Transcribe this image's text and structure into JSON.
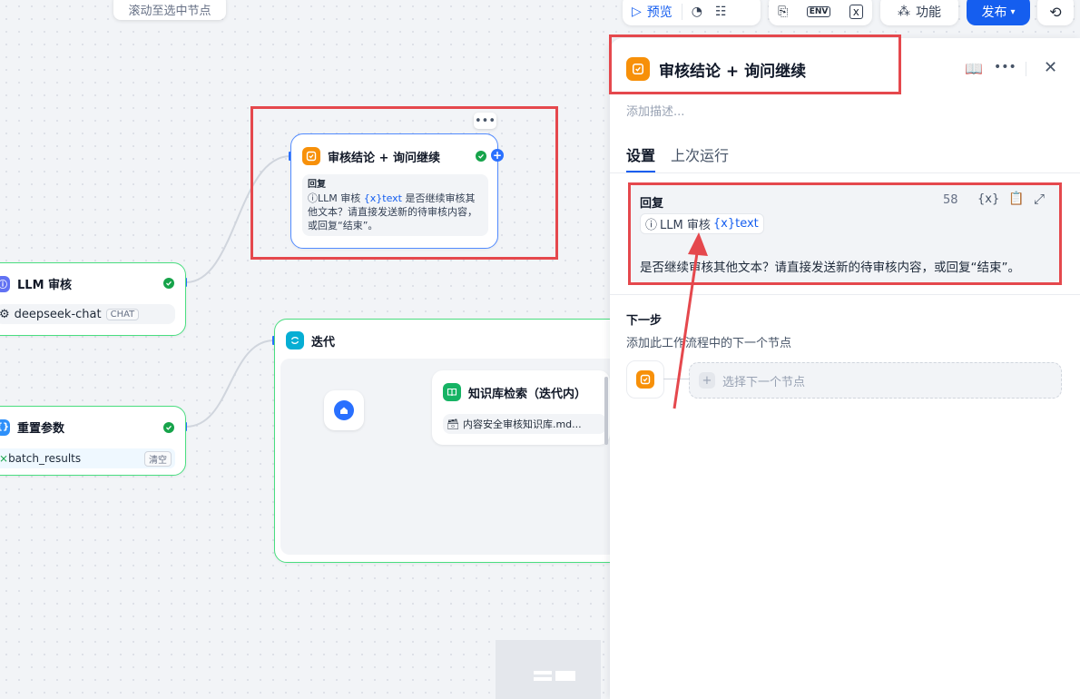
{
  "canvas": {
    "scroll_hint": "滚动至选中节点",
    "nodes": {
      "reply": {
        "title": "审核结论 + 询问继续",
        "section_label": "回复",
        "var_node": "LLM 审核",
        "var_name": "{x}text",
        "body_text": "是否继续审核其他文本？请直接发送新的待审核内容，或回复“结束”。"
      },
      "llm": {
        "title": "LLM 审核",
        "model": "deepseek-chat",
        "model_tag": "CHAT"
      },
      "reset": {
        "title": "重置参数",
        "var": "batch_results",
        "clear_label": "清空"
      },
      "iteration": {
        "title": "迭代"
      },
      "kb": {
        "title": "知识库检索（迭代内）",
        "dataset": "内容安全审核知识库.md..."
      }
    }
  },
  "toolbar": {
    "preview_label": "预览",
    "features_label": "功能",
    "publish_label": "发布",
    "env_label": "ENV"
  },
  "panel": {
    "title": "审核结论 + 询问继续",
    "description_placeholder": "添加描述...",
    "tabs": [
      "设置",
      "上次运行"
    ],
    "reply": {
      "label": "回复",
      "char_count": "58",
      "var_node": "LLM 审核",
      "var_name": "{x}text",
      "text": "是否继续审核其他文本？请直接发送新的待审核内容，或回复“结束”。"
    },
    "next_step": {
      "title": "下一步",
      "description": "添加此工作流程中的下一个节点",
      "select_label": "选择下一个节点"
    }
  },
  "colors": {
    "accent": "#155eef",
    "highlight_red": "#e5484d",
    "node_border_green": "#4ade80",
    "reply_icon_orange": "#f79009"
  }
}
